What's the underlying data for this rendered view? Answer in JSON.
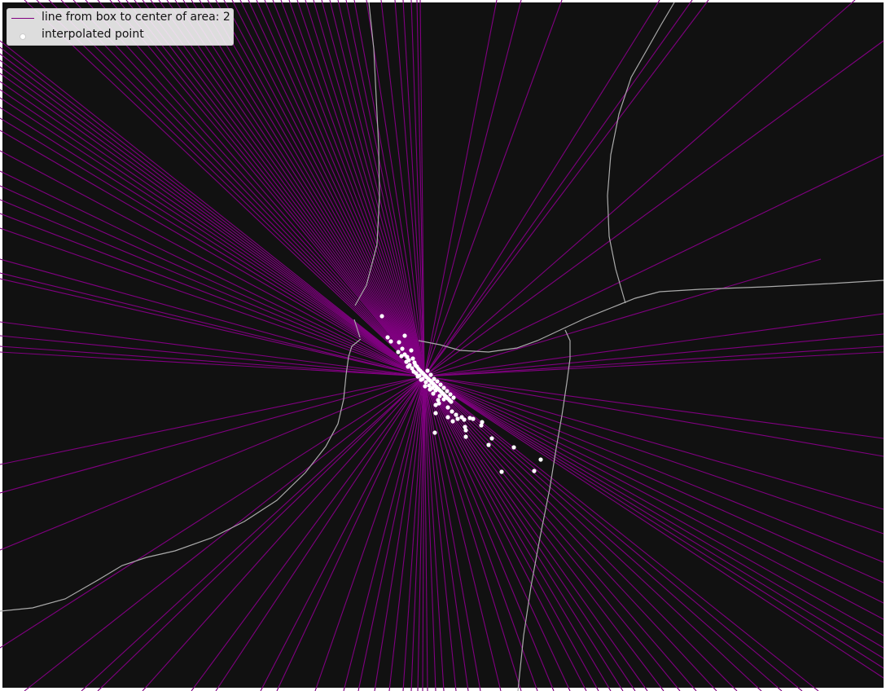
{
  "chart_data": {
    "type": "scatter",
    "title": "",
    "xlabel": "",
    "ylabel": "",
    "grid": false,
    "legend_position": "top-left",
    "background_color": "#111111",
    "line_color": "#800080",
    "point_color": "#ffffff",
    "road_color": "#aaaaaa",
    "center_point": [
      521,
      462
    ],
    "series": [
      {
        "name": "line from box to center of area: 2",
        "kind": "lines",
        "endpoints": [
          [
            0,
            50
          ],
          [
            0,
            58
          ],
          [
            0,
            66
          ],
          [
            0,
            74
          ],
          [
            0,
            82
          ],
          [
            0,
            90
          ],
          [
            0,
            100
          ],
          [
            0,
            110
          ],
          [
            0,
            120
          ],
          [
            0,
            132
          ],
          [
            0,
            145
          ],
          [
            0,
            160
          ],
          [
            0,
            185
          ],
          [
            0,
            210
          ],
          [
            0,
            228
          ],
          [
            0,
            245
          ],
          [
            0,
            262
          ],
          [
            0,
            280
          ],
          [
            0,
            318
          ],
          [
            0,
            335
          ],
          [
            0,
            342
          ],
          [
            0,
            395
          ],
          [
            0,
            412
          ],
          [
            0,
            425
          ],
          [
            0,
            432
          ],
          [
            0,
            570
          ],
          [
            0,
            605
          ],
          [
            0,
            675
          ],
          [
            0,
            795
          ],
          [
            30,
            0
          ],
          [
            45,
            0
          ],
          [
            60,
            0
          ],
          [
            75,
            0
          ],
          [
            90,
            0
          ],
          [
            105,
            0
          ],
          [
            120,
            0
          ],
          [
            135,
            0
          ],
          [
            145,
            0
          ],
          [
            155,
            0
          ],
          [
            165,
            0
          ],
          [
            175,
            0
          ],
          [
            185,
            0
          ],
          [
            195,
            0
          ],
          [
            205,
            0
          ],
          [
            215,
            0
          ],
          [
            225,
            0
          ],
          [
            235,
            0
          ],
          [
            245,
            0
          ],
          [
            255,
            0
          ],
          [
            265,
            0
          ],
          [
            275,
            0
          ],
          [
            285,
            0
          ],
          [
            295,
            0
          ],
          [
            305,
            0
          ],
          [
            315,
            0
          ],
          [
            325,
            0
          ],
          [
            335,
            0
          ],
          [
            345,
            0
          ],
          [
            355,
            0
          ],
          [
            365,
            0
          ],
          [
            375,
            0
          ],
          [
            385,
            0
          ],
          [
            395,
            0
          ],
          [
            405,
            0
          ],
          [
            415,
            0
          ],
          [
            425,
            0
          ],
          [
            435,
            0
          ],
          [
            450,
            0
          ],
          [
            468,
            0
          ],
          [
            485,
            0
          ],
          [
            495,
            0
          ],
          [
            505,
            0
          ],
          [
            512,
            0
          ],
          [
            516,
            0
          ],
          [
            610,
            0
          ],
          [
            640,
            0
          ],
          [
            690,
            0
          ],
          [
            810,
            0
          ],
          [
            850,
            0
          ],
          [
            870,
            0
          ],
          [
            1050,
            0
          ],
          [
            1085,
            50
          ],
          [
            1085,
            190
          ],
          [
            1085,
            385
          ],
          [
            1085,
            410
          ],
          [
            1085,
            425
          ],
          [
            1085,
            432
          ],
          [
            1085,
            538
          ],
          [
            1085,
            560
          ],
          [
            1085,
            625
          ],
          [
            1085,
            655
          ],
          [
            1085,
            690
          ],
          [
            1085,
            715
          ],
          [
            1085,
            740
          ],
          [
            1085,
            760
          ],
          [
            1085,
            780
          ],
          [
            1085,
            795
          ],
          [
            1085,
            808
          ],
          [
            1085,
            820
          ],
          [
            1085,
            832
          ],
          [
            1008,
            318
          ],
          [
            1005,
            848
          ],
          [
            985,
            848
          ],
          [
            960,
            848
          ],
          [
            935,
            848
          ],
          [
            905,
            848
          ],
          [
            880,
            848
          ],
          [
            855,
            848
          ],
          [
            835,
            848
          ],
          [
            815,
            848
          ],
          [
            795,
            848
          ],
          [
            780,
            848
          ],
          [
            765,
            848
          ],
          [
            750,
            848
          ],
          [
            735,
            848
          ],
          [
            720,
            848
          ],
          [
            700,
            848
          ],
          [
            680,
            848
          ],
          [
            660,
            848
          ],
          [
            640,
            848
          ],
          [
            615,
            848
          ],
          [
            590,
            848
          ],
          [
            575,
            848
          ],
          [
            560,
            848
          ],
          [
            545,
            848
          ],
          [
            535,
            848
          ],
          [
            525,
            848
          ],
          [
            519,
            848
          ],
          [
            513,
            848
          ],
          [
            505,
            848
          ],
          [
            495,
            848
          ],
          [
            478,
            848
          ],
          [
            460,
            848
          ],
          [
            440,
            848
          ],
          [
            422,
            848
          ],
          [
            387,
            848
          ],
          [
            340,
            848
          ],
          [
            320,
            848
          ],
          [
            265,
            848
          ],
          [
            235,
            848
          ],
          [
            175,
            848
          ],
          [
            120,
            848
          ],
          [
            100,
            848
          ],
          [
            30,
            848
          ]
        ]
      },
      {
        "name": "interpolated point",
        "kind": "points",
        "points": [
          [
            469,
            388
          ],
          [
            497,
            412
          ],
          [
            476,
            414
          ],
          [
            480,
            419
          ],
          [
            490,
            420
          ],
          [
            489,
            432
          ],
          [
            494,
            428
          ],
          [
            497,
            435
          ],
          [
            500,
            438
          ],
          [
            502,
            442
          ],
          [
            505,
            430
          ],
          [
            507,
            440
          ],
          [
            509,
            445
          ],
          [
            510,
            448
          ],
          [
            512,
            450
          ],
          [
            514,
            453
          ],
          [
            516,
            455
          ],
          [
            518,
            457
          ],
          [
            520,
            459
          ],
          [
            522,
            461
          ],
          [
            524,
            463
          ],
          [
            526,
            465
          ],
          [
            528,
            467
          ],
          [
            530,
            469
          ],
          [
            532,
            471
          ],
          [
            534,
            473
          ],
          [
            536,
            475
          ],
          [
            538,
            477
          ],
          [
            540,
            479
          ],
          [
            542,
            481
          ],
          [
            544,
            483
          ],
          [
            546,
            485
          ],
          [
            548,
            487
          ],
          [
            550,
            489
          ],
          [
            552,
            491
          ],
          [
            554,
            493
          ],
          [
            503,
            448
          ],
          [
            506,
            452
          ],
          [
            511,
            458
          ],
          [
            515,
            461
          ],
          [
            519,
            465
          ],
          [
            523,
            469
          ],
          [
            527,
            473
          ],
          [
            531,
            476
          ],
          [
            535,
            479
          ],
          [
            525,
            455
          ],
          [
            529,
            460
          ],
          [
            533,
            465
          ],
          [
            537,
            468
          ],
          [
            541,
            472
          ],
          [
            545,
            476
          ],
          [
            549,
            480
          ],
          [
            553,
            484
          ],
          [
            557,
            488
          ],
          [
            535,
            497
          ],
          [
            538,
            491
          ],
          [
            550,
            500
          ],
          [
            555,
            505
          ],
          [
            560,
            509
          ],
          [
            567,
            512
          ],
          [
            550,
            512
          ],
          [
            556,
            517
          ],
          [
            562,
            514
          ],
          [
            570,
            515
          ],
          [
            577,
            513
          ],
          [
            581,
            514
          ],
          [
            591,
            522
          ],
          [
            592,
            518
          ],
          [
            571,
            524
          ],
          [
            572,
            528
          ],
          [
            535,
            507
          ],
          [
            534,
            531
          ],
          [
            572,
            536
          ],
          [
            604,
            538
          ],
          [
            600,
            546
          ],
          [
            631,
            549
          ],
          [
            664,
            564
          ],
          [
            616,
            579
          ],
          [
            656,
            578
          ],
          [
            522,
            474
          ],
          [
            528,
            478
          ],
          [
            532,
            483
          ],
          [
            540,
            486
          ],
          [
            545,
            490
          ],
          [
            539,
            495
          ],
          [
            517,
            466
          ],
          [
            513,
            462
          ],
          [
            508,
            456
          ],
          [
            501,
            450
          ],
          [
            499,
            444
          ],
          [
            493,
            437
          ]
        ]
      }
    ],
    "roads": [
      [
        [
          453,
          3
        ],
        [
          459,
          60
        ],
        [
          462,
          120
        ],
        [
          465,
          180
        ],
        [
          466,
          240
        ],
        [
          463,
          300
        ],
        [
          450,
          350
        ],
        [
          436,
          375
        ]
      ],
      [
        [
          435,
          392
        ],
        [
          442,
          414
        ]
      ],
      [
        [
          443,
          416
        ],
        [
          432,
          425
        ],
        [
          428,
          438
        ],
        [
          425,
          460
        ],
        [
          422,
          490
        ],
        [
          415,
          520
        ],
        [
          400,
          548
        ],
        [
          375,
          580
        ],
        [
          340,
          614
        ],
        [
          300,
          640
        ],
        [
          260,
          660
        ],
        [
          215,
          676
        ],
        [
          180,
          684
        ],
        [
          150,
          694
        ],
        [
          120,
          712
        ],
        [
          80,
          735
        ],
        [
          40,
          746
        ],
        [
          0,
          750
        ]
      ],
      [
        [
          828,
          3
        ],
        [
          812,
          30
        ],
        [
          795,
          60
        ],
        [
          775,
          95
        ],
        [
          760,
          140
        ],
        [
          750,
          190
        ],
        [
          746,
          240
        ],
        [
          748,
          290
        ],
        [
          756,
          330
        ],
        [
          768,
          372
        ]
      ],
      [
        [
          514,
          418
        ],
        [
          540,
          423
        ],
        [
          565,
          430
        ],
        [
          600,
          432
        ],
        [
          635,
          427
        ],
        [
          660,
          418
        ],
        [
          690,
          404
        ],
        [
          720,
          390
        ],
        [
          750,
          378
        ],
        [
          780,
          366
        ],
        [
          810,
          358
        ],
        [
          860,
          355
        ],
        [
          940,
          352
        ],
        [
          1020,
          348
        ],
        [
          1085,
          344
        ]
      ],
      [
        [
          694,
          405
        ],
        [
          700,
          418
        ],
        [
          700,
          440
        ],
        [
          696,
          470
        ],
        [
          690,
          510
        ],
        [
          683,
          550
        ],
        [
          675,
          600
        ],
        [
          663,
          660
        ],
        [
          652,
          720
        ],
        [
          643,
          780
        ],
        [
          636,
          848
        ]
      ]
    ]
  }
}
